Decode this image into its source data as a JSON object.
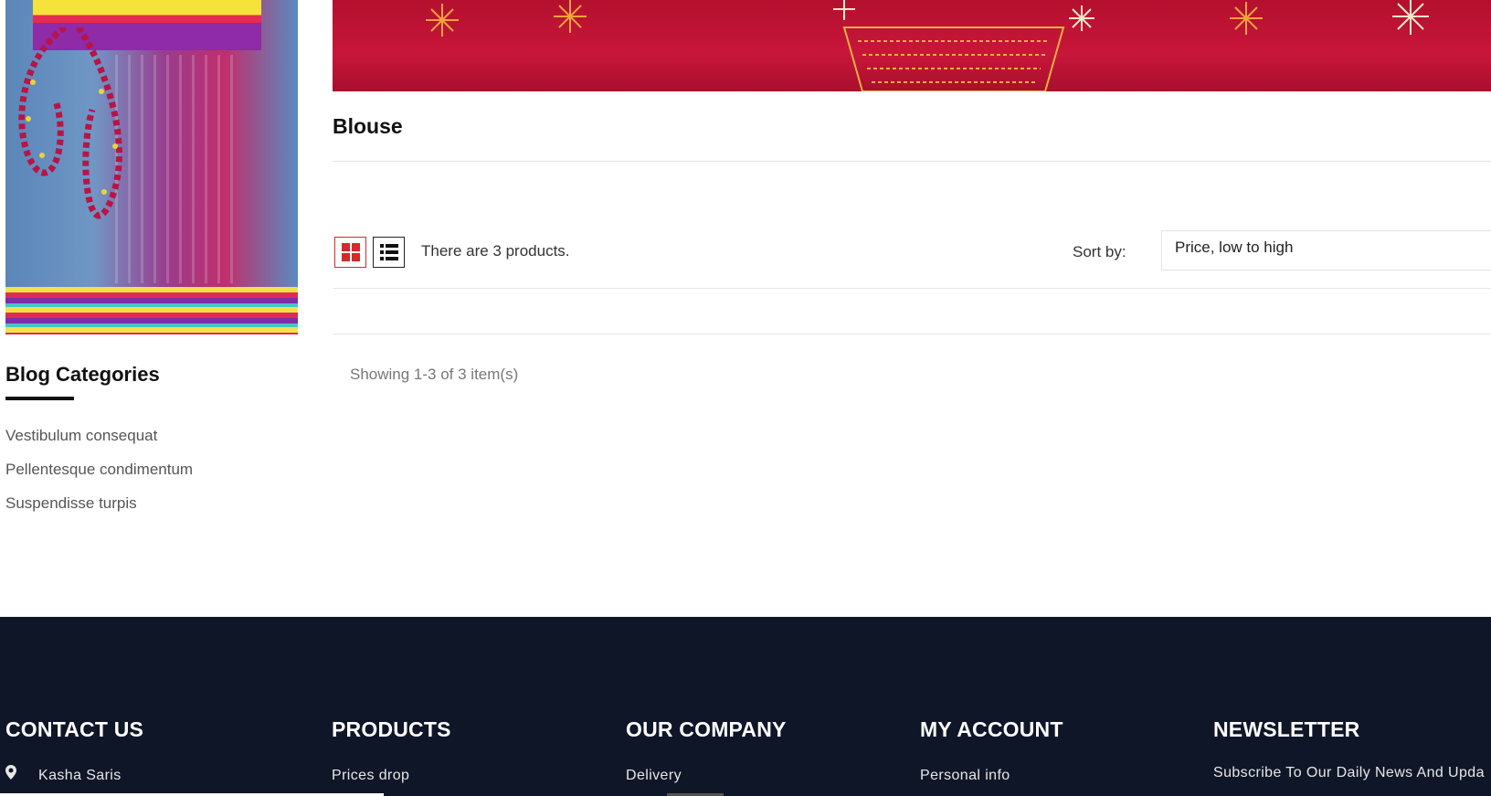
{
  "sidebar": {
    "blog_title": "Blog Categories",
    "blog_items": [
      "Vestibulum consequat",
      "Pellentesque condimentum",
      "Suspendisse turpis"
    ]
  },
  "main": {
    "category_title": "Blouse",
    "product_count": "There are 3 products.",
    "sort_label": "Sort by:",
    "sort_selected": "Price, low to high",
    "showing": "Showing 1-3 of 3 item(s)"
  },
  "footer": {
    "contact": {
      "title": "CONTACT US",
      "first_line": "Kasha Saris"
    },
    "products": {
      "title": "PRODUCTS",
      "first_link": "Prices drop"
    },
    "company": {
      "title": "OUR COMPANY",
      "first_link": "Delivery"
    },
    "account": {
      "title": "MY ACCOUNT",
      "first_link": "Personal info"
    },
    "newsletter": {
      "title": "NEWSLETTER",
      "text": "Subscribe To Our Daily News And Upda"
    }
  },
  "colors": {
    "footer_bg": "#0f1628",
    "accent_red": "#d42a2a",
    "hero_red": "#c8163a"
  },
  "icons": {
    "grid_view": "grid-view-icon",
    "list_view": "list-view-icon",
    "location": "location-pin-icon"
  }
}
